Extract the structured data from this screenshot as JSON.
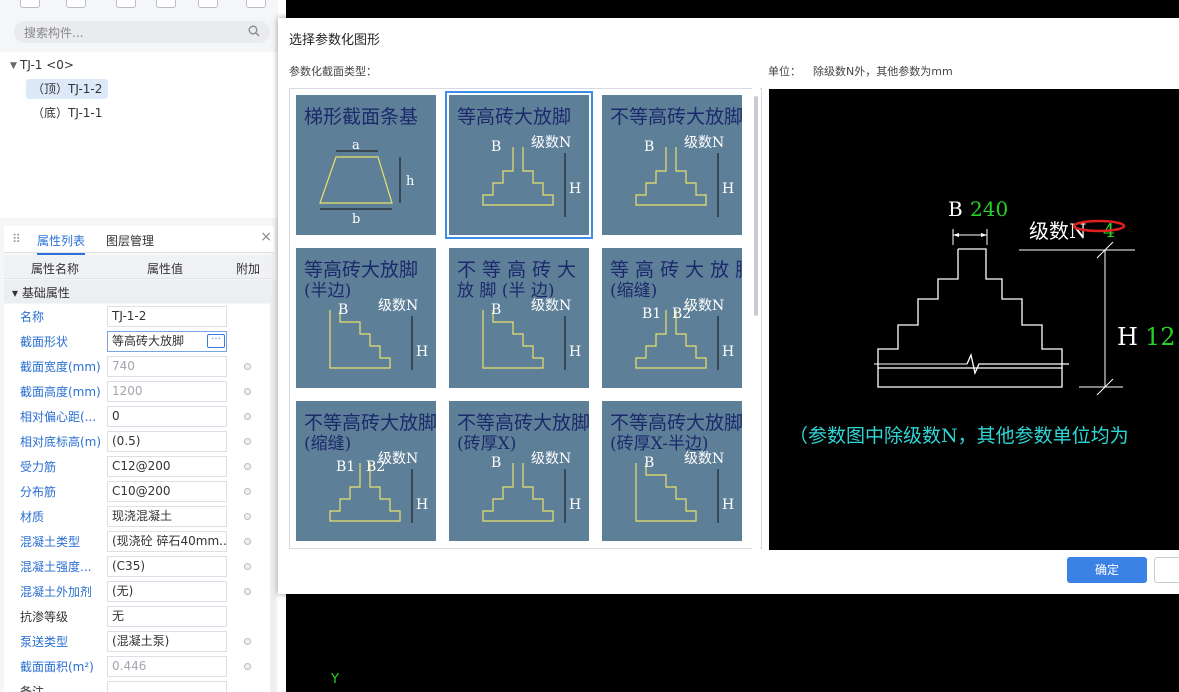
{
  "search": {
    "placeholder": "搜索构件..."
  },
  "tree": {
    "root": "TJ-1 <0>",
    "children": [
      "（顶）TJ-1-2",
      "（底）TJ-1-1"
    ]
  },
  "props_tabs": [
    "属性列表",
    "图层管理"
  ],
  "grid_headers": {
    "name": "属性名称",
    "value": "属性值",
    "attach": "附加"
  },
  "section": "基础属性",
  "properties": [
    {
      "name": "名称",
      "value": "TJ-1-2"
    },
    {
      "name": "截面形状",
      "value": "等高砖大放脚"
    },
    {
      "name": "截面宽度(mm)",
      "value": "740"
    },
    {
      "name": "截面高度(mm)",
      "value": "1200"
    },
    {
      "name": "相对偏心距(...",
      "value": "0"
    },
    {
      "name": "相对底标高(m)",
      "value": "(0.5)"
    },
    {
      "name": "受力筋",
      "value": "C12@200"
    },
    {
      "name": "分布筋",
      "value": "C10@200"
    },
    {
      "name": "材质",
      "value": "现浇混凝土"
    },
    {
      "name": "混凝土类型",
      "value": "(现浇砼 碎石40mm..."
    },
    {
      "name": "混凝土强度...",
      "value": "(C35)"
    },
    {
      "name": "混凝土外加剂",
      "value": "(无)"
    },
    {
      "name": "抗渗等级",
      "value": "无"
    },
    {
      "name": "泵送类型",
      "value": "(混凝土泵)"
    },
    {
      "name": "截面面积(m²)",
      "value": "0.446"
    },
    {
      "name": "备注",
      "value": ""
    }
  ],
  "dialog": {
    "title": "选择参数化图形",
    "subtitle": "参数化截面类型：",
    "unit_label": "单位：",
    "unit_text": "除级数N外，其他参数为mm",
    "ok": "确定"
  },
  "thumbnails": [
    {
      "title1": "梯形截面条基",
      "title2": ""
    },
    {
      "title1": "等高砖大放脚",
      "title2": ""
    },
    {
      "title1": "不等高砖大放脚",
      "title2": ""
    },
    {
      "title1": "等高砖大放脚",
      "title2": "(半边)"
    },
    {
      "title1": "不 等 高 砖 大",
      "title2": "放 脚 (半 边)"
    },
    {
      "title1": "等 高 砖 大 放 脚",
      "title2": "(缩缝)"
    },
    {
      "title1": "不等高砖大放脚",
      "title2": "(缩缝)"
    },
    {
      "title1": "不等高砖大放脚",
      "title2": "(砖厚X)"
    },
    {
      "title1": "不等高砖大放脚",
      "title2": "(砖厚X-半边)"
    }
  ],
  "thumb_labels": {
    "a": "a",
    "b": "b",
    "h": "h",
    "B": "B",
    "H": "H",
    "N": "级数N",
    "B1": "B1",
    "B2": "B2"
  },
  "preview": {
    "b_label": "B",
    "b_value": "240",
    "n_label": "级数N",
    "n_value": "4",
    "h_label": "H",
    "h_value": "12",
    "note": "（参数图中除级数N，其他参数单位均为"
  },
  "canvas": {
    "axis": "Y"
  },
  "colors": {
    "accent": "#3b82e6",
    "thumb_bg": "#5e7f98",
    "thumb_text": "#1b2a6b",
    "preview_green": "#27d227",
    "preview_cyan": "#2fd6d6",
    "marker_red": "#e02020"
  }
}
